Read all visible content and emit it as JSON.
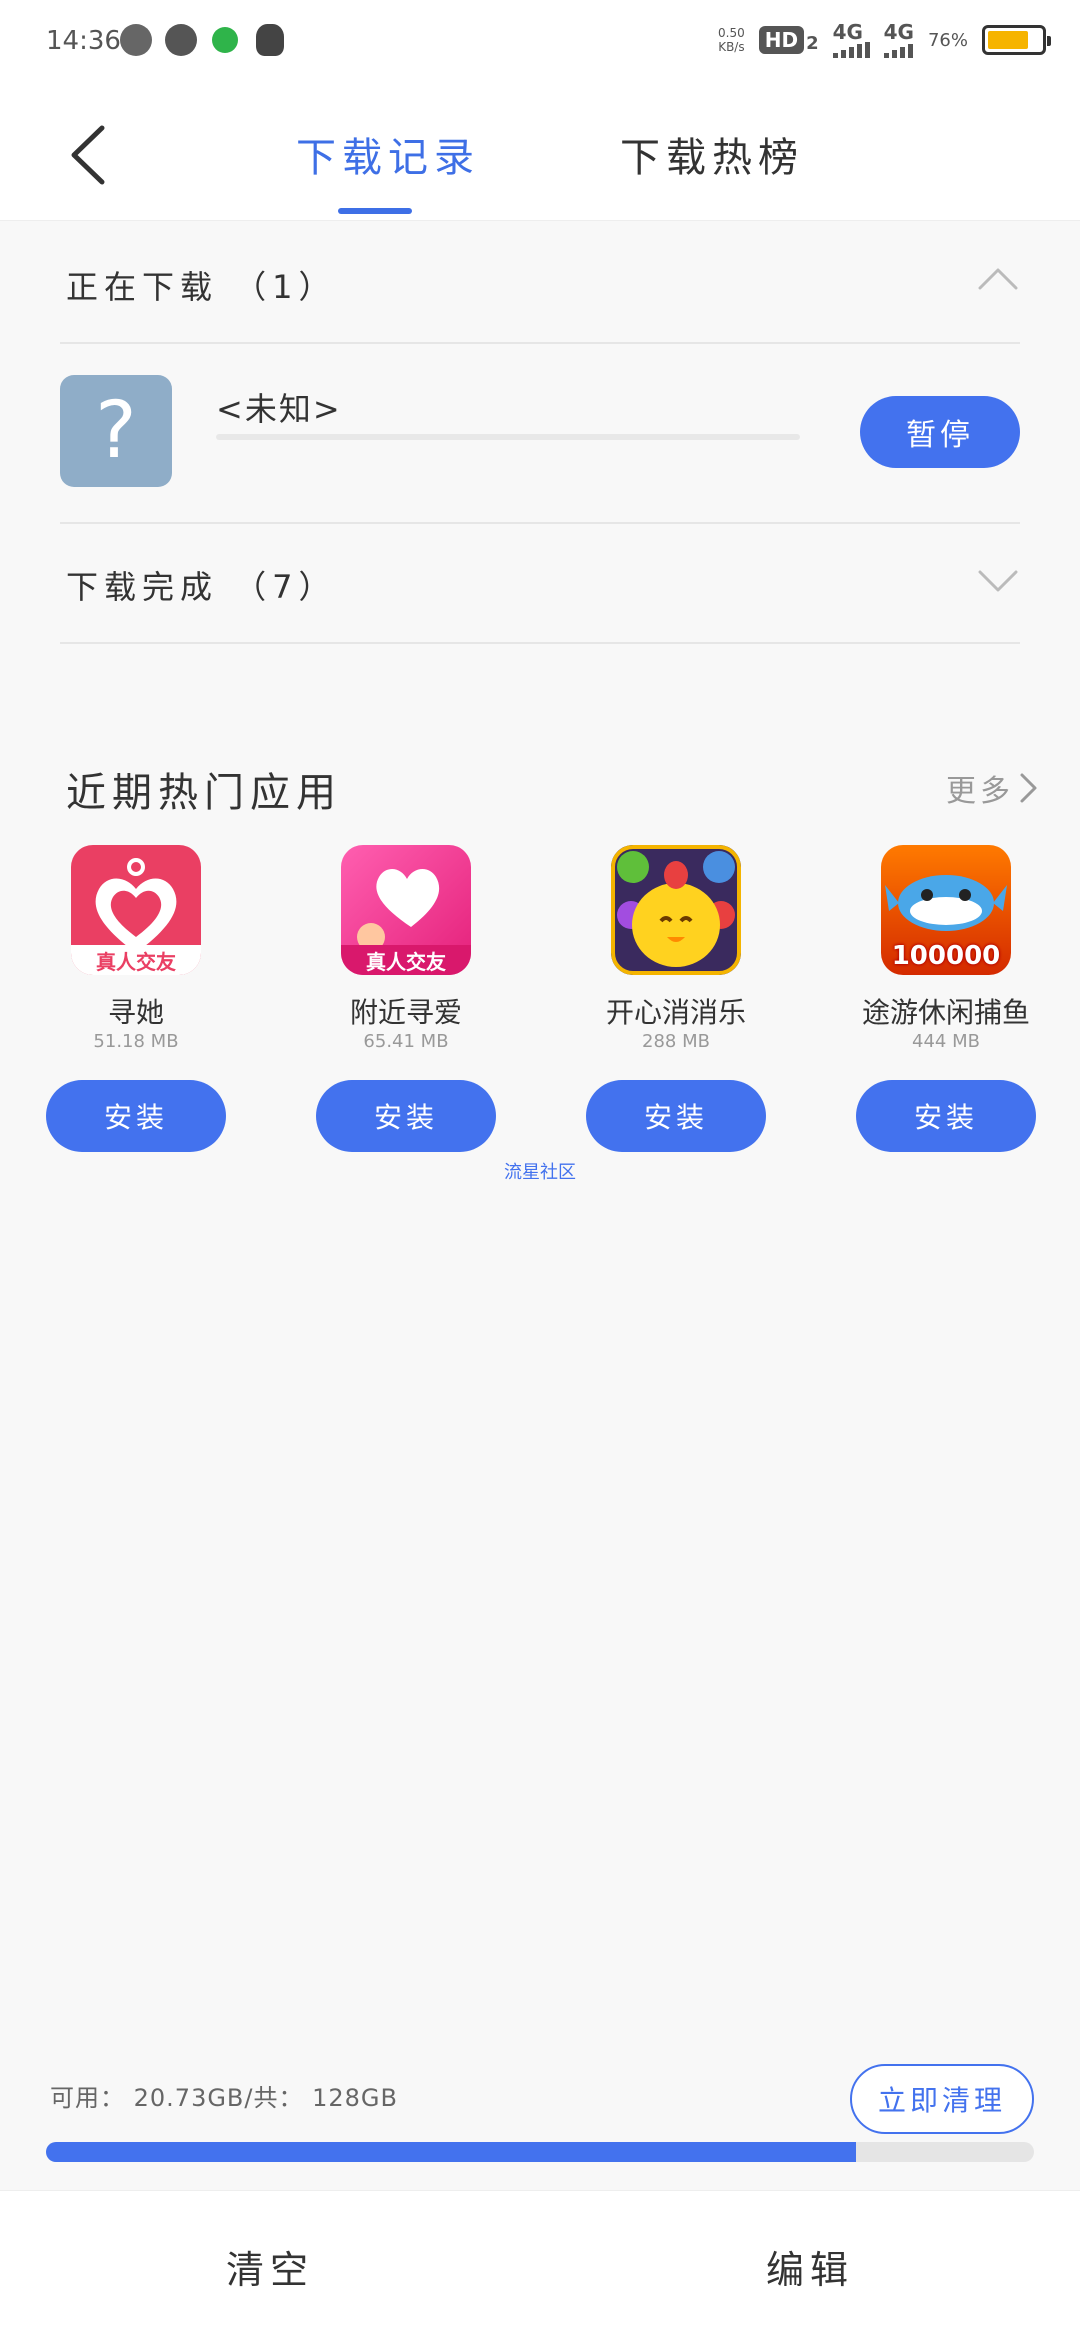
{
  "status_bar": {
    "time": "14:36",
    "speed_value": "0.50",
    "speed_unit": "KB/s",
    "hd_label": "HD",
    "hd_sub": "2",
    "sim1_label": "4G",
    "sim2_label": "4G",
    "battery_percent": "76%",
    "battery_level": 0.76,
    "battery_color": "#f6b400"
  },
  "header": {
    "back_icon": "back-arrow-icon",
    "tabs": [
      {
        "label": "下载记录",
        "active": true
      },
      {
        "label": "下载热榜",
        "active": false
      }
    ],
    "accent_color": "#3e6fe6"
  },
  "downloading": {
    "title": "正在下载 （1）",
    "item": {
      "name": "<未知>",
      "icon_glyph": "?",
      "progress": 0,
      "action_label": "暂停"
    }
  },
  "completed": {
    "title": "下载完成 （7）"
  },
  "hot_apps": {
    "title": "近期热门应用",
    "more_label": "更多",
    "install_label": "安装",
    "apps": [
      {
        "name": "寻她",
        "size": "51.18 MB",
        "badge": "真人交友"
      },
      {
        "name": "附近寻爱",
        "size": "65.41 MB",
        "badge": "真人交友"
      },
      {
        "name": "开心消消乐",
        "size": "288 MB",
        "badge": ""
      },
      {
        "name": "途游休闲捕鱼",
        "size": "444 MB",
        "badge": "100000"
      }
    ],
    "community_label": "流星社区"
  },
  "storage": {
    "text": "可用： 20.73GB/共： 128GB",
    "used_fraction": 0.82,
    "clean_label": "立即清理"
  },
  "bottom_bar": {
    "clear_label": "清空",
    "edit_label": "编辑"
  }
}
